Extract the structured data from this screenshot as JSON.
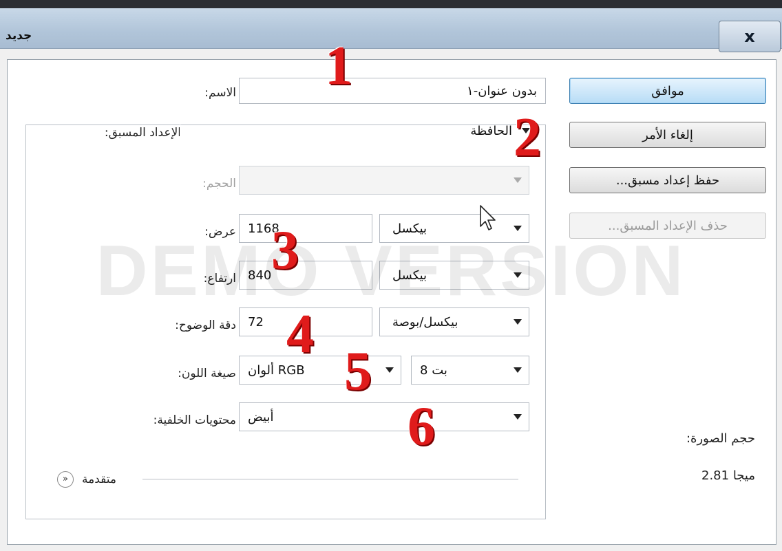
{
  "window": {
    "title": "جديد",
    "close_label": "x"
  },
  "form": {
    "name": {
      "label": ":الاسم",
      "value": "بدون عنوان-١"
    },
    "preset": {
      "label": ":الإعداد المسبق",
      "value": "الحافظة"
    },
    "size": {
      "label": ":الحجم",
      "value": ""
    },
    "width": {
      "label": ":عرض",
      "value": "1168",
      "unit": "بيكسل"
    },
    "height": {
      "label": ":ارتفاع",
      "value": "840",
      "unit": "بيكسل"
    },
    "resolution": {
      "label": ":دقة الوضوح",
      "value": "72",
      "unit": "بيكسل/بوصة"
    },
    "color_mode": {
      "label": ":صيغة اللون",
      "value": "ألوان RGB",
      "depth": "8 بت"
    },
    "background": {
      "label": ":محتويات الخلفية",
      "value": "أبيض"
    },
    "advanced": {
      "label": "متقدمة"
    }
  },
  "buttons": {
    "ok": "موافق",
    "cancel": "إلغاء الأمر",
    "save_preset": "...حفظ إعداد مسبق",
    "delete_preset": "...حذف الإعداد المسبق"
  },
  "image_size": {
    "label": ":حجم الصورة",
    "value": "2.81 ميجا"
  },
  "watermark": "DEMO VERSION",
  "annotations": [
    "1",
    "2",
    "3",
    "4",
    "5",
    "6"
  ],
  "colors": {
    "annotation": "#e01b1b",
    "default_button": "#b7dcf6",
    "titlebar": "#b2c6da"
  }
}
